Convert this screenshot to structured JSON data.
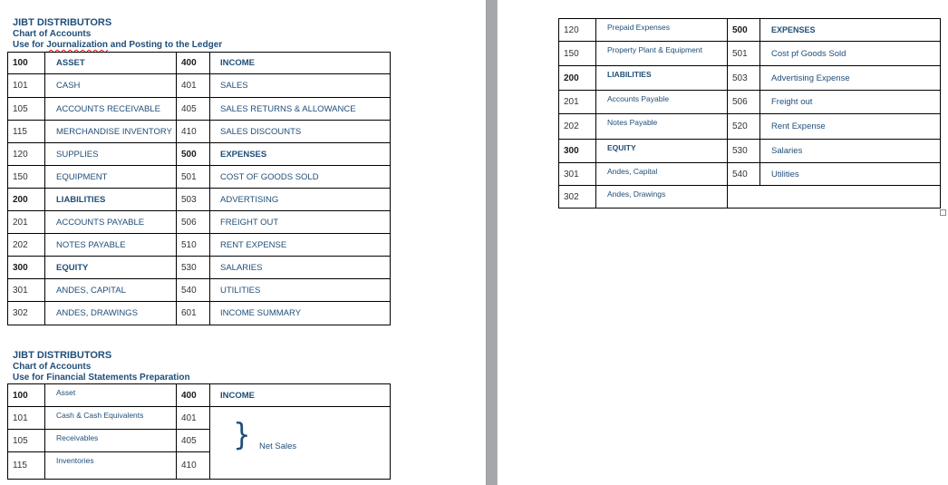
{
  "left_page": {
    "section1": {
      "company": "JIBT DISTRIBUTORS",
      "title": "Chart of Accounts",
      "subtitle_prefix": "Use for ",
      "subtitle_misspelled_word": "Journalization",
      "subtitle_suffix": " and Posting to the Ledger",
      "rows": [
        {
          "c1": "100",
          "n1": "ASSET",
          "c2": "400",
          "n2": "INCOME",
          "bold1": true,
          "bold2": true
        },
        {
          "c1": "101",
          "n1": "CASH",
          "c2": "401",
          "n2": "SALES"
        },
        {
          "c1": "105",
          "n1": "ACCOUNTS RECEIVABLE",
          "c2": "405",
          "n2": "SALES RETURNS & ALLOWANCE"
        },
        {
          "c1": "115",
          "n1": "MERCHANDISE INVENTORY",
          "c2": "410",
          "n2": "SALES DISCOUNTS"
        },
        {
          "c1": "120",
          "n1": "SUPPLIES",
          "c2": "500",
          "n2": "EXPENSES",
          "bold2": true
        },
        {
          "c1": "150",
          "n1": "EQUIPMENT",
          "c2": "501",
          "n2": "COST OF GOODS SOLD"
        },
        {
          "c1": "200",
          "n1": "LIABILITIES",
          "c2": "503",
          "n2": "ADVERTISING",
          "bold1": true
        },
        {
          "c1": "201",
          "n1": "ACCOUNTS PAYABLE",
          "c2": "506",
          "n2": "FREIGHT OUT"
        },
        {
          "c1": "202",
          "n1": "NOTES PAYABLE",
          "c2": "510",
          "n2": "RENT EXPENSE"
        },
        {
          "c1": "300",
          "n1": "EQUITY",
          "c2": "530",
          "n2": "SALARIES",
          "bold1": true
        },
        {
          "c1": "301",
          "n1": "ANDES, CAPITAL",
          "c2": "540",
          "n2": "UTILITIES"
        },
        {
          "c1": "302",
          "n1": "ANDES, DRAWINGS",
          "c2": "601",
          "n2": "INCOME SUMMARY"
        }
      ]
    },
    "section2": {
      "company": "JIBT DISTRIBUTORS",
      "title": "Chart of Accounts",
      "subtitle": "Use for Financial Statements Preparation",
      "rows": [
        {
          "c1": "100",
          "n1": "Asset",
          "c2": "400",
          "n2": "INCOME"
        },
        {
          "c1": "101",
          "n1": "Cash & Cash Equivalents",
          "c2": "401"
        },
        {
          "c1": "105",
          "n1": "Receivables",
          "c2": "405"
        },
        {
          "c1": "115",
          "n1": "Inventories",
          "c2": "410"
        }
      ],
      "brace_symbol": "}",
      "brace_label": "Net Sales"
    }
  },
  "right_page": {
    "rows": [
      {
        "c1": "120",
        "n1": "Prepaid Expenses",
        "c2": "500",
        "n2": "EXPENSES"
      },
      {
        "c1": "150",
        "n1": "Property Plant & Equipment",
        "c2": "501",
        "n2": "Cost pf Goods Sold"
      },
      {
        "c1": "200",
        "n1": "LIABILITIES",
        "c2": "503",
        "n2": "Advertising Expense"
      },
      {
        "c1": "201",
        "n1": "Accounts Payable",
        "c2": "506",
        "n2": "Freight out"
      },
      {
        "c1": "202",
        "n1": "Notes Payable",
        "c2": "520",
        "n2": "Rent Expense"
      },
      {
        "c1": "300",
        "n1": "EQUITY",
        "c2": "530",
        "n2": "Salaries"
      },
      {
        "c1": "301",
        "n1": "Andes, Capital",
        "c2": "540",
        "n2": "Utilities"
      },
      {
        "c1": "302",
        "n1": "Andes, Drawings"
      }
    ]
  },
  "colors": {
    "text": "#1f4e79",
    "border": "#000000",
    "page_gap": "#a5a7aa"
  }
}
